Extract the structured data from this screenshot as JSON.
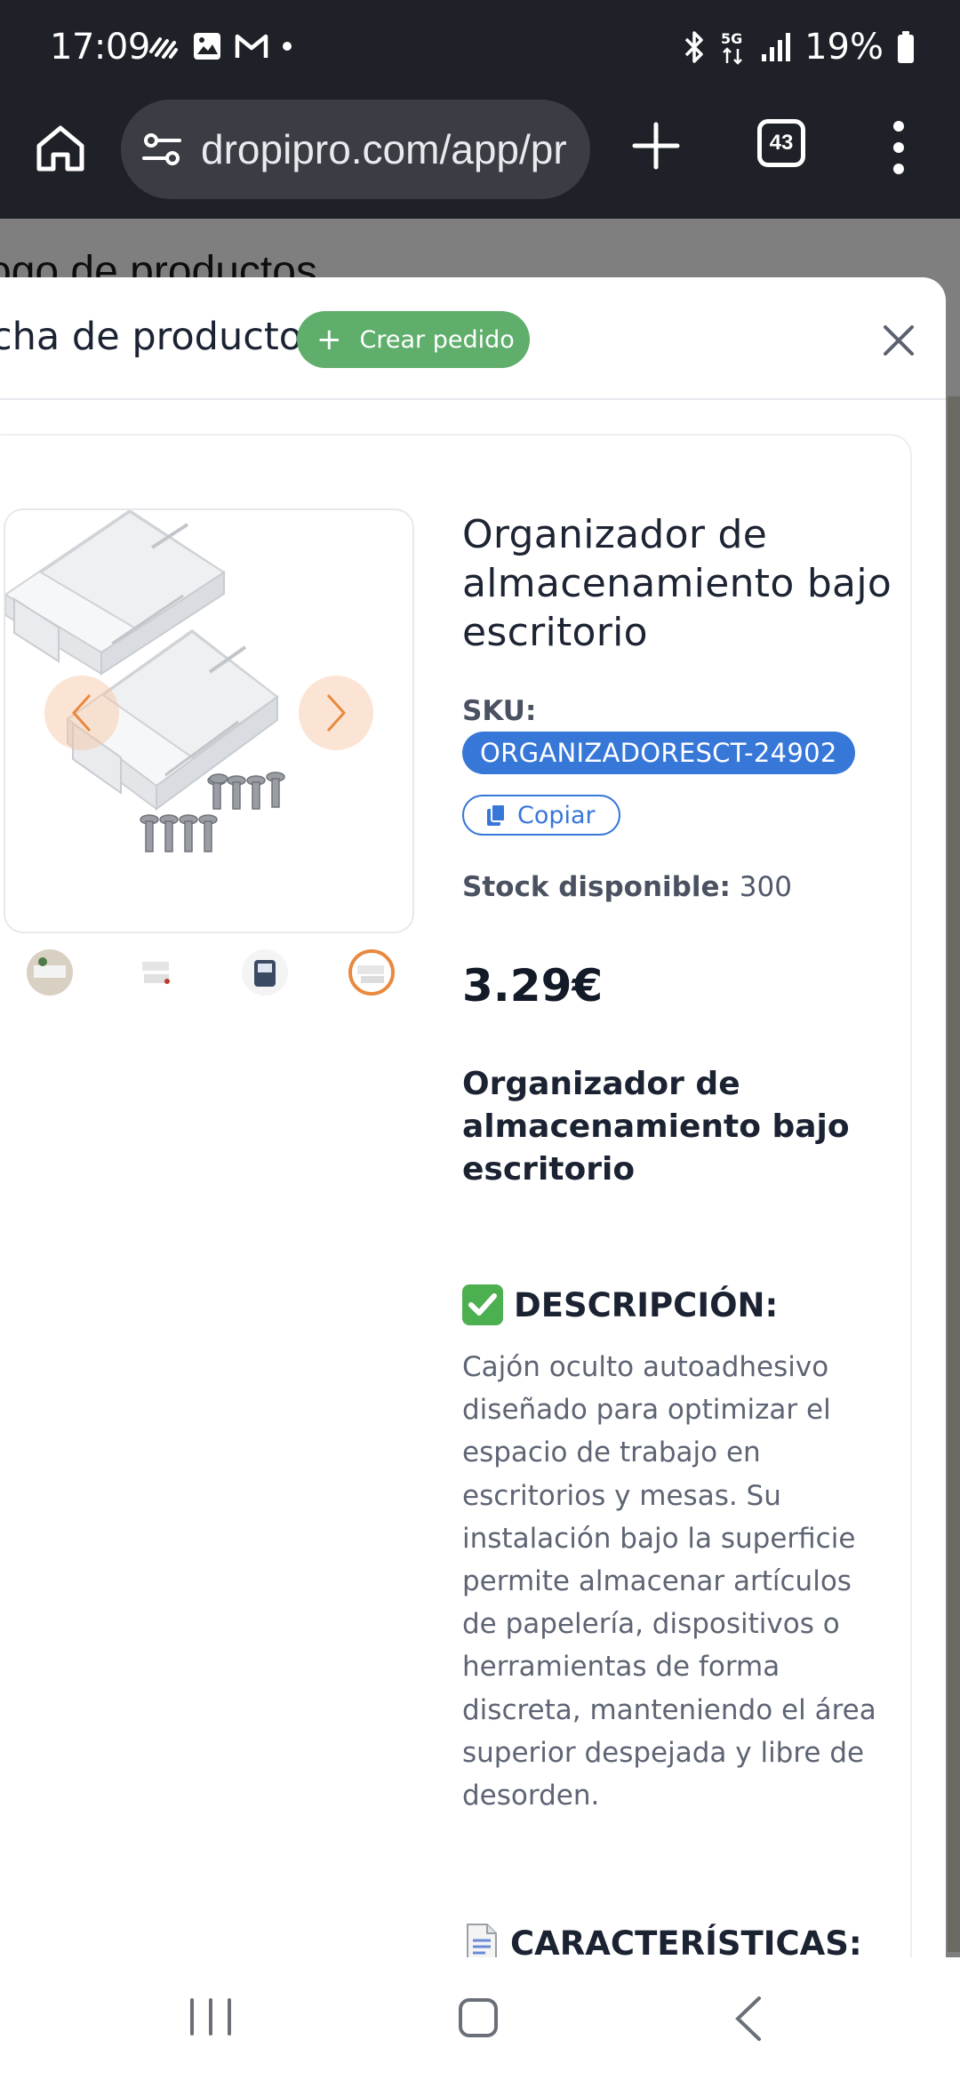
{
  "status_bar": {
    "time": "17:09",
    "battery": "19%",
    "network": "5G",
    "icons": [
      "signal-wave-icon",
      "gallery-icon",
      "gmail-icon",
      "dot-icon",
      "bluetooth-icon",
      "5g-icon",
      "signal-bars-icon",
      "battery-icon"
    ]
  },
  "browser": {
    "url": "dropipro.com/app/pr",
    "tab_count": "43"
  },
  "background_page": {
    "title": "ogo de productos"
  },
  "modal": {
    "title": "cha de producto",
    "create_order_label": "Crear pedido",
    "close_icon": "close-icon"
  },
  "product": {
    "name": "Organizador de almacenamiento bajo escritorio",
    "sku_label": "SKU:",
    "sku": "ORGANIZADORESCT-24902",
    "copy_label": "Copiar",
    "stock_label": "Stock disponible:",
    "stock_value": "300",
    "price": "3.29€",
    "subtitle": "Organizador de almacenamiento bajo escritorio",
    "description_heading": "DESCRIPCIÓN:",
    "description": "Cajón oculto autoadhesivo diseñado para optimizar el espacio de trabajo en escritorios y mesas. Su instalación bajo la superficie permite almacenar artículos de papelería, dispositivos o herramientas de forma discreta, manteniendo el área superior despejada y libre de desorden.",
    "features_heading": "CARACTERÍSTICAS:",
    "thumbnails": [
      "thumb-1",
      "thumb-2",
      "thumb-3",
      "thumb-4"
    ],
    "active_thumbnail_index": 3
  },
  "colors": {
    "accent_green": "#5fae6b",
    "sku_blue": "#3777d8",
    "thumb_active": "#e8893f"
  }
}
